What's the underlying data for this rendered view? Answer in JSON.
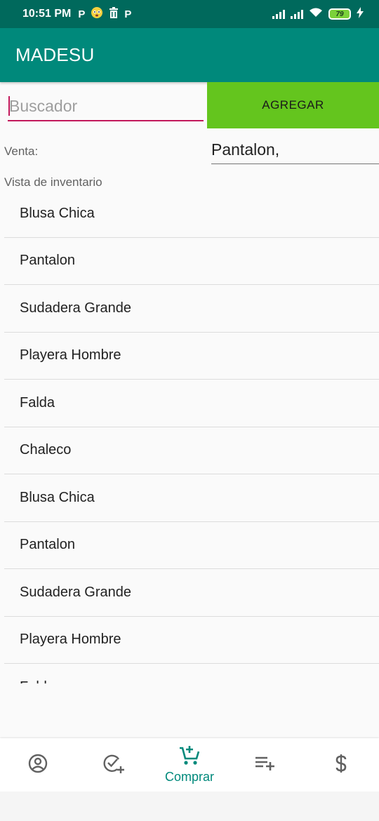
{
  "status_bar": {
    "time": "10:51 PM",
    "notification_icons": [
      "p-app-icon",
      "emoji-icon",
      "trash-icon",
      "p-app-icon"
    ],
    "battery_level": "79",
    "battery_color": "#7bd13a"
  },
  "app_bar": {
    "title": "MADESU",
    "color": "#00897b"
  },
  "search": {
    "placeholder": "Buscador",
    "value": ""
  },
  "add_button": {
    "label": "AGREGAR",
    "color": "#64c51e"
  },
  "venta": {
    "label": "Venta:",
    "value": "Pantalon,"
  },
  "inventory": {
    "label": "Vista de inventario",
    "items": [
      "Blusa Chica",
      "Pantalon",
      "Sudadera Grande",
      "Playera Hombre",
      "Falda",
      "Chaleco",
      "Blusa Chica",
      "Pantalon",
      "Sudadera Grande",
      "Playera Hombre",
      "Falda"
    ]
  },
  "bottom_nav": {
    "items": [
      {
        "icon": "account-circle-icon",
        "label": ""
      },
      {
        "icon": "check-add-icon",
        "label": ""
      },
      {
        "icon": "cart-add-icon",
        "label": "Comprar",
        "active": true
      },
      {
        "icon": "playlist-add-icon",
        "label": ""
      },
      {
        "icon": "dollar-icon",
        "label": ""
      }
    ],
    "active_color": "#00897b"
  }
}
